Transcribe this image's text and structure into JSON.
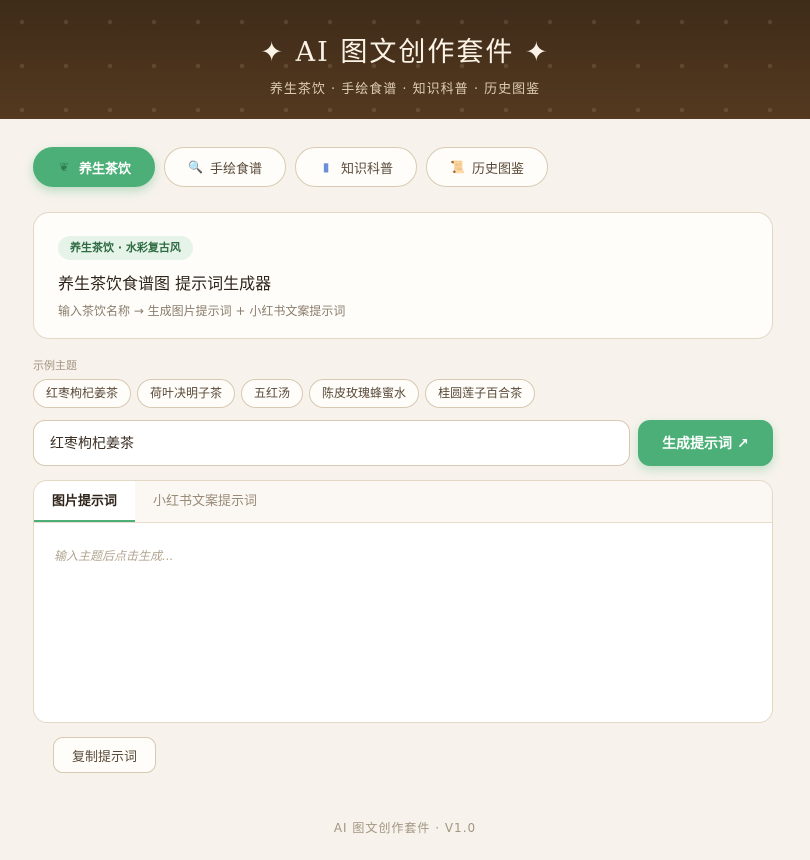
{
  "header": {
    "title": "✦ AI 图文创作套件 ✦",
    "subtitle": "养生茶饮 · 手绘食谱 · 知识科普 · 历史图鉴"
  },
  "tabs": [
    {
      "label": "养生茶饮",
      "icon": "leaf-icon",
      "glyph": "❦",
      "active": true
    },
    {
      "label": "手绘食谱",
      "icon": "magnifier-icon",
      "glyph": "🔍",
      "active": false
    },
    {
      "label": "知识科普",
      "icon": "books-icon",
      "glyph": "▮",
      "active": false
    },
    {
      "label": "历史图鉴",
      "icon": "scroll-icon",
      "glyph": "📜",
      "active": false
    }
  ],
  "card": {
    "badge": "养生茶饮 · 水彩复古风",
    "title": "养生茶饮食谱图 提示词生成器",
    "description": "输入茶饮名称 → 生成图片提示词 + 小红书文案提示词"
  },
  "examples": {
    "label": "示例主题",
    "items": [
      "红枣枸杞姜茶",
      "荷叶决明子茶",
      "五红汤",
      "陈皮玫瑰蜂蜜水",
      "桂圆莲子百合茶"
    ]
  },
  "input": {
    "value": "红枣枸杞姜茶"
  },
  "generate_label": "生成提示词 ↗",
  "output": {
    "tabs": [
      {
        "label": "图片提示词",
        "active": true
      },
      {
        "label": "小红书文案提示词",
        "active": false
      }
    ],
    "placeholder": "输入主题后点击生成..."
  },
  "copy_label": "复制提示词",
  "footer": "AI 图文创作套件 · V1.0",
  "colors": {
    "accent": "#4caf78",
    "header": "#4a3320",
    "background": "#f7f3ec"
  }
}
